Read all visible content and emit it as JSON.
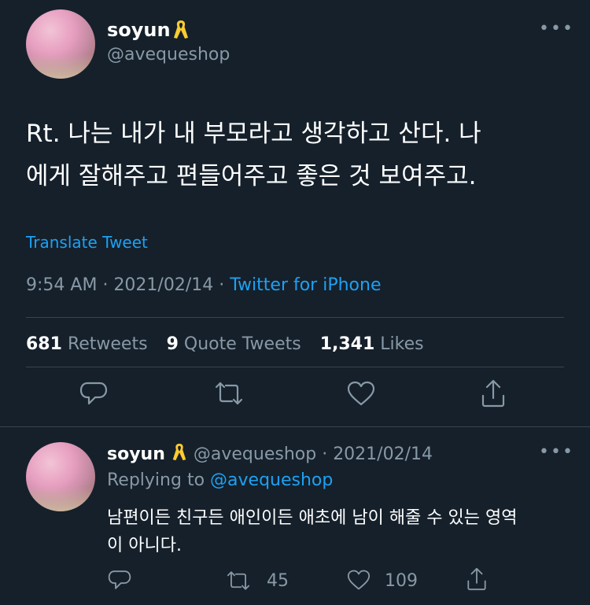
{
  "main_tweet": {
    "display_name": "soyun",
    "handle": "@avequeshop",
    "text_line1": "Rt. 나는 내가 내 부모라고 생각하고 산다. 나",
    "text_line2": "에게 잘해주고 편들어주고 좋은 것 보여주고.",
    "translate_label": "Translate Tweet",
    "time": "9:54 AM",
    "date": "2021/02/14",
    "source": "Twitter for iPhone",
    "sep": "·",
    "stats": {
      "retweets_count": "681",
      "retweets_label": "Retweets",
      "quotes_count": "9",
      "quotes_label": "Quote Tweets",
      "likes_count": "1,341",
      "likes_label": "Likes"
    }
  },
  "reply_tweet": {
    "display_name": "soyun",
    "handle": "@avequeshop",
    "sep": "·",
    "date": "2021/02/14",
    "replying_prefix": "Replying to",
    "replying_to": "@avequeshop",
    "text_line1": "남편이든 친구든 애인이든 애초에 남이 해줄 수 있는 영역",
    "text_line2": "이 아니다.",
    "retweets": "45",
    "likes": "109"
  },
  "icons": {
    "ribbon": "yellow-ribbon-icon",
    "more": "more-dots-icon",
    "reply": "reply-icon",
    "retweet": "retweet-icon",
    "like": "heart-icon",
    "share": "share-icon"
  },
  "colors": {
    "background": "#15202b",
    "muted": "#8899a6",
    "accent": "#1da1f2",
    "ribbon": "#ffcc2f"
  }
}
